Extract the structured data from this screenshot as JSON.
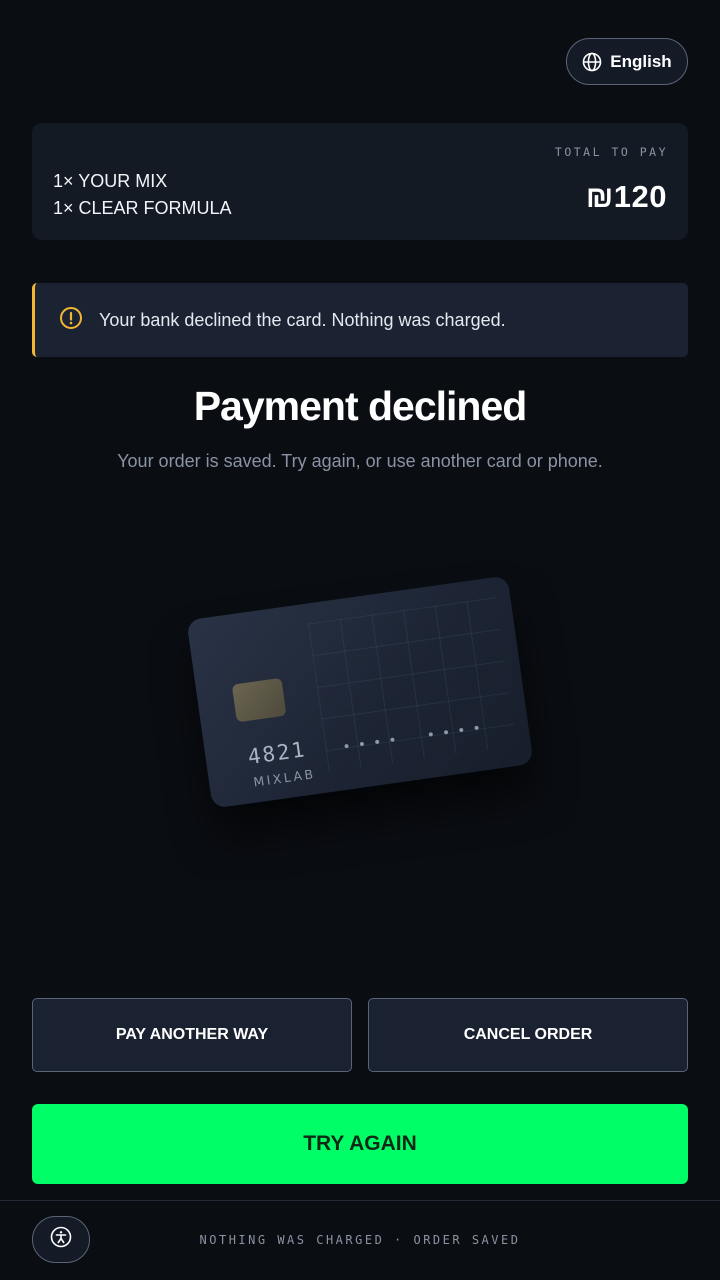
{
  "header": {
    "language_label": "English",
    "language_icon": "globe-icon"
  },
  "order": {
    "items": [
      "1× YOUR MIX",
      "1× CLEAR FORMULA"
    ],
    "total_label": "TOTAL TO PAY",
    "total_amount": "₪120"
  },
  "alert": {
    "icon": "warning-icon",
    "message": "Your bank declined the card. Nothing was charged.",
    "accent_color": "#f2b632"
  },
  "status": {
    "title": "Payment declined",
    "subtitle": "Your order is saved. Try again, or use another card or phone."
  },
  "card": {
    "last_digits": "4821",
    "masked_group_1": "••••",
    "masked_group_2": "••••",
    "brand": "MIXLAB"
  },
  "actions": {
    "pay_another_way": "PAY ANOTHER WAY",
    "cancel_order": "CANCEL ORDER",
    "try_again": "TRY AGAIN",
    "primary_color": "#00ff66"
  },
  "footer": {
    "accessibility_icon": "accessibility-icon",
    "status_text": "NOTHING WAS CHARGED · ORDER SAVED"
  }
}
